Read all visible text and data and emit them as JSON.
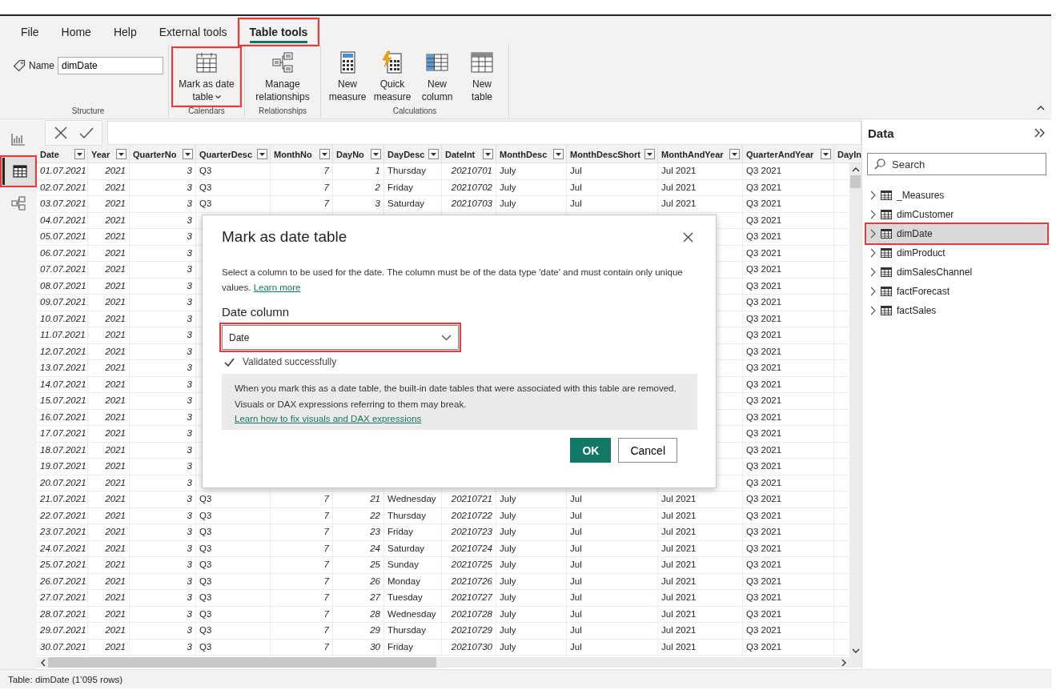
{
  "ribbon": {
    "tabs": [
      {
        "label": "File",
        "selected": false,
        "highlighted": false
      },
      {
        "label": "Home",
        "selected": false,
        "highlighted": false
      },
      {
        "label": "Help",
        "selected": false,
        "highlighted": false
      },
      {
        "label": "External tools",
        "selected": false,
        "highlighted": false
      },
      {
        "label": "Table tools",
        "selected": true,
        "highlighted": true
      }
    ],
    "name_label": "Name",
    "name_value": "dimDate",
    "groups": [
      {
        "label": "Structure",
        "kind": "name"
      },
      {
        "label": "Calendars",
        "kind": "buttons",
        "buttons": [
          {
            "label": "Mark as date table",
            "kind": "calendar",
            "dropdown": true,
            "highlighted": true
          }
        ]
      },
      {
        "label": "Relationships",
        "kind": "buttons",
        "buttons": [
          {
            "label": "Manage relationships",
            "kind": "relationships",
            "dropdown": false,
            "highlighted": false
          }
        ]
      },
      {
        "label": "Calculations",
        "kind": "buttons",
        "buttons": [
          {
            "label": "New measure",
            "kind": "calculator",
            "dropdown": false,
            "highlighted": false
          },
          {
            "label": "Quick measure",
            "kind": "quick",
            "dropdown": false,
            "highlighted": false
          },
          {
            "label": "New column",
            "kind": "column",
            "dropdown": false,
            "highlighted": false
          },
          {
            "label": "New table",
            "kind": "table",
            "dropdown": false,
            "highlighted": false
          }
        ]
      }
    ]
  },
  "views": [
    {
      "kind": "report",
      "selected": false,
      "highlighted": false
    },
    {
      "kind": "table",
      "selected": true,
      "highlighted": true
    },
    {
      "kind": "model",
      "selected": false,
      "highlighted": false
    }
  ],
  "table": {
    "columns": [
      {
        "label": "Date",
        "kind": "date",
        "filter": true
      },
      {
        "label": "Year",
        "kind": "number",
        "filter": true
      },
      {
        "label": "QuarterNo",
        "kind": "number",
        "filter": true
      },
      {
        "label": "QuarterDesc",
        "kind": "text",
        "filter": true
      },
      {
        "label": "MonthNo",
        "kind": "number",
        "filter": true
      },
      {
        "label": "DayNo",
        "kind": "number",
        "filter": true
      },
      {
        "label": "DayDesc",
        "kind": "text",
        "filter": true
      },
      {
        "label": "DateInt",
        "kind": "number",
        "filter": true
      },
      {
        "label": "MonthDesc",
        "kind": "text",
        "filter": true
      },
      {
        "label": "MonthDescShort",
        "kind": "text",
        "filter": true
      },
      {
        "label": "MonthAndYear",
        "kind": "text",
        "filter": true
      },
      {
        "label": "QuarterAndYear",
        "kind": "text",
        "filter": true
      },
      {
        "label": "DayIn",
        "kind": "text",
        "filter": false
      }
    ],
    "rows": [
      {
        "kind": "full",
        "cells": [
          "01.07.2021",
          "2021",
          "3",
          "Q3",
          "7",
          "1",
          "Thursday",
          "20210701",
          "July",
          "Jul",
          "Jul 2021",
          "Q3 2021"
        ]
      },
      {
        "kind": "full",
        "cells": [
          "02.07.2021",
          "2021",
          "3",
          "Q3",
          "7",
          "2",
          "Friday",
          "20210702",
          "July",
          "Jul",
          "Jul 2021",
          "Q3 2021"
        ]
      },
      {
        "kind": "full",
        "cells": [
          "03.07.2021",
          "2021",
          "3",
          "Q3",
          "7",
          "3",
          "Saturday",
          "20210703",
          "July",
          "Jul",
          "Jul 2021",
          "Q3 2021"
        ]
      },
      {
        "kind": "partial",
        "cells": [
          "04.07.2021",
          "2021",
          "3",
          "Q3 2021"
        ]
      },
      {
        "kind": "partial",
        "cells": [
          "05.07.2021",
          "2021",
          "3",
          "Q3 2021"
        ]
      },
      {
        "kind": "partial",
        "cells": [
          "06.07.2021",
          "2021",
          "3",
          "Q3 2021"
        ]
      },
      {
        "kind": "partial",
        "cells": [
          "07.07.2021",
          "2021",
          "3",
          "Q3 2021"
        ]
      },
      {
        "kind": "partial",
        "cells": [
          "08.07.2021",
          "2021",
          "3",
          "Q3 2021"
        ]
      },
      {
        "kind": "partial",
        "cells": [
          "09.07.2021",
          "2021",
          "3",
          "Q3 2021"
        ]
      },
      {
        "kind": "partial",
        "cells": [
          "10.07.2021",
          "2021",
          "3",
          "Q3 2021"
        ]
      },
      {
        "kind": "partial",
        "cells": [
          "11.07.2021",
          "2021",
          "3",
          "Q3 2021"
        ]
      },
      {
        "kind": "partial",
        "cells": [
          "12.07.2021",
          "2021",
          "3",
          "Q3 2021"
        ]
      },
      {
        "kind": "partial",
        "cells": [
          "13.07.2021",
          "2021",
          "3",
          "Q3 2021"
        ]
      },
      {
        "kind": "partial",
        "cells": [
          "14.07.2021",
          "2021",
          "3",
          "Q3 2021"
        ]
      },
      {
        "kind": "partial",
        "cells": [
          "15.07.2021",
          "2021",
          "3",
          "Q3 2021"
        ]
      },
      {
        "kind": "partial",
        "cells": [
          "16.07.2021",
          "2021",
          "3",
          "Q3 2021"
        ]
      },
      {
        "kind": "partial",
        "cells": [
          "17.07.2021",
          "2021",
          "3",
          "Q3 2021"
        ]
      },
      {
        "kind": "partial",
        "cells": [
          "18.07.2021",
          "2021",
          "3",
          "Q3 2021"
        ]
      },
      {
        "kind": "partial",
        "cells": [
          "19.07.2021",
          "2021",
          "3",
          "Q3 2021"
        ]
      },
      {
        "kind": "partial",
        "cells": [
          "20.07.2021",
          "2021",
          "3",
          "Q3 2021"
        ]
      },
      {
        "kind": "full",
        "cells": [
          "21.07.2021",
          "2021",
          "3",
          "Q3",
          "7",
          "21",
          "Wednesday",
          "20210721",
          "July",
          "Jul",
          "Jul 2021",
          "Q3 2021"
        ]
      },
      {
        "kind": "full",
        "cells": [
          "22.07.2021",
          "2021",
          "3",
          "Q3",
          "7",
          "22",
          "Thursday",
          "20210722",
          "July",
          "Jul",
          "Jul 2021",
          "Q3 2021"
        ]
      },
      {
        "kind": "full",
        "cells": [
          "23.07.2021",
          "2021",
          "3",
          "Q3",
          "7",
          "23",
          "Friday",
          "20210723",
          "July",
          "Jul",
          "Jul 2021",
          "Q3 2021"
        ]
      },
      {
        "kind": "full",
        "cells": [
          "24.07.2021",
          "2021",
          "3",
          "Q3",
          "7",
          "24",
          "Saturday",
          "20210724",
          "July",
          "Jul",
          "Jul 2021",
          "Q3 2021"
        ]
      },
      {
        "kind": "full",
        "cells": [
          "25.07.2021",
          "2021",
          "3",
          "Q3",
          "7",
          "25",
          "Sunday",
          "20210725",
          "July",
          "Jul",
          "Jul 2021",
          "Q3 2021"
        ]
      },
      {
        "kind": "full",
        "cells": [
          "26.07.2021",
          "2021",
          "3",
          "Q3",
          "7",
          "26",
          "Monday",
          "20210726",
          "July",
          "Jul",
          "Jul 2021",
          "Q3 2021"
        ]
      },
      {
        "kind": "full",
        "cells": [
          "27.07.2021",
          "2021",
          "3",
          "Q3",
          "7",
          "27",
          "Tuesday",
          "20210727",
          "July",
          "Jul",
          "Jul 2021",
          "Q3 2021"
        ]
      },
      {
        "kind": "full",
        "cells": [
          "28.07.2021",
          "2021",
          "3",
          "Q3",
          "7",
          "28",
          "Wednesday",
          "20210728",
          "July",
          "Jul",
          "Jul 2021",
          "Q3 2021"
        ]
      },
      {
        "kind": "full",
        "cells": [
          "29.07.2021",
          "2021",
          "3",
          "Q3",
          "7",
          "29",
          "Thursday",
          "20210729",
          "July",
          "Jul",
          "Jul 2021",
          "Q3 2021"
        ]
      },
      {
        "kind": "full",
        "cells": [
          "30.07.2021",
          "2021",
          "3",
          "Q3",
          "7",
          "30",
          "Friday",
          "20210730",
          "July",
          "Jul",
          "Jul 2021",
          "Q3 2021"
        ]
      }
    ]
  },
  "data_pane": {
    "title": "Data",
    "search": {
      "placeholder": "Search"
    },
    "items": [
      {
        "label": "_Measures",
        "selected": false,
        "highlighted": false
      },
      {
        "label": "dimCustomer",
        "selected": false,
        "highlighted": false
      },
      {
        "label": "dimDate",
        "selected": true,
        "highlighted": true
      },
      {
        "label": "dimProduct",
        "selected": false,
        "highlighted": false
      },
      {
        "label": "dimSalesChannel",
        "selected": false,
        "highlighted": false
      },
      {
        "label": "factForecast",
        "selected": false,
        "highlighted": false
      },
      {
        "label": "factSales",
        "selected": false,
        "highlighted": false
      }
    ]
  },
  "dialog": {
    "title": "Mark as date table",
    "description": "Select a column to be used for the date. The column must be of the data type 'date' and must contain only unique values.",
    "description_link": "Learn more",
    "field_label": "Date column",
    "field_value": "Date",
    "field_highlighted": true,
    "validation": "Validated successfully",
    "warning": "When you mark this as a date table, the built-in date tables that were associated with this table are removed. Visuals or DAX expressions referring to them may break.",
    "warning_link": "Learn how to fix visuals and DAX expressions",
    "buttons": [
      {
        "label": "OK",
        "kind": "primary"
      },
      {
        "label": "Cancel",
        "kind": "secondary"
      }
    ]
  },
  "status_bar": "Table: dimDate (1’095 rows)"
}
